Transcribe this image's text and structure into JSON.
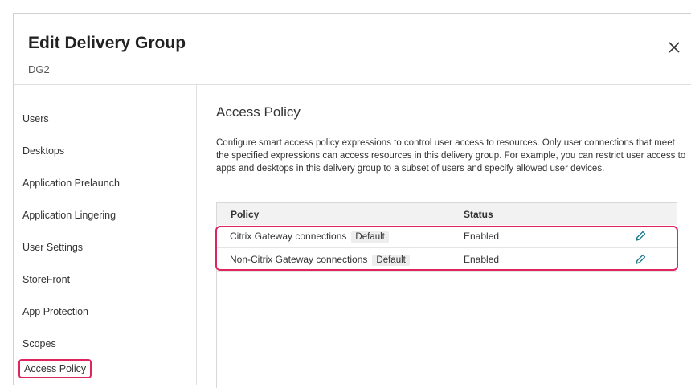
{
  "dialog": {
    "title": "Edit Delivery Group",
    "subtitle": "DG2",
    "close_icon": "close-icon"
  },
  "sidebar": {
    "items": [
      {
        "label": "Users",
        "active": false
      },
      {
        "label": "Desktops",
        "active": false
      },
      {
        "label": "Application Prelaunch",
        "active": false
      },
      {
        "label": "Application Lingering",
        "active": false
      },
      {
        "label": "User Settings",
        "active": false
      },
      {
        "label": "StoreFront",
        "active": false
      },
      {
        "label": "App Protection",
        "active": false
      },
      {
        "label": "Scopes",
        "active": false
      },
      {
        "label": "Access Policy",
        "active": true
      }
    ]
  },
  "main": {
    "title": "Access Policy",
    "description": "Configure smart access policy expressions to control user access to resources. Only user connections that meet the specified expressions can access resources in this delivery group. For example, you can restrict user access to apps and desktops in this delivery group to a subset of users and specify allowed user devices.",
    "table": {
      "headers": {
        "policy": "Policy",
        "status": "Status"
      },
      "rows": [
        {
          "policy": "Citrix Gateway connections",
          "badge": "Default",
          "status": "Enabled",
          "icon": "pencil-icon"
        },
        {
          "policy": "Non-Citrix Gateway connections",
          "badge": "Default",
          "status": "Enabled",
          "icon": "pencil-icon"
        }
      ]
    }
  },
  "colors": {
    "highlight": "#e0245e",
    "edit_icon": "#1a7a8a",
    "header_bg": "#f2f2f2"
  }
}
